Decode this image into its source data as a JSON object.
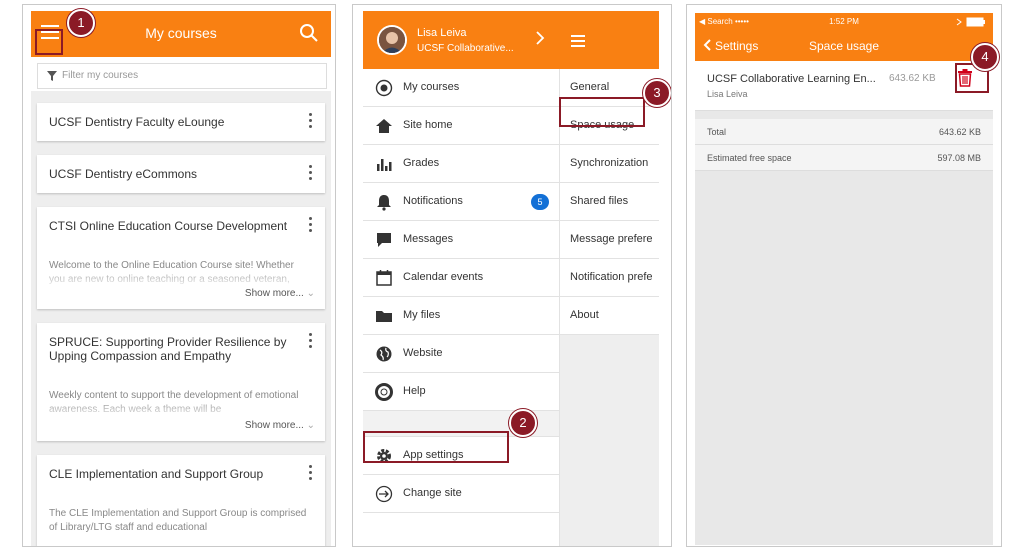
{
  "colors": {
    "brand": "#f98012",
    "callout": "#8b1a26",
    "badge_blue": "#1370d6"
  },
  "callouts": [
    "1",
    "2",
    "3",
    "4"
  ],
  "screen1": {
    "title": "My courses",
    "filter_placeholder": "Filter my courses",
    "courses": [
      {
        "title": "UCSF Dentistry Faculty eLounge"
      },
      {
        "title": "UCSF Dentistry eCommons"
      },
      {
        "title": "CTSI Online Education Course Development",
        "description": "Welcome to the Online Education Course site! Whether you are new to online teaching or a seasoned veteran,",
        "show_more": "Show more..."
      },
      {
        "title": "SPRUCE: Supporting Provider Resilience by Upping Compassion and Empathy",
        "description": "Weekly content to support the development of emotional awareness. Each week a theme will be",
        "show_more": "Show more..."
      },
      {
        "title": "CLE Implementation and Support Group",
        "description": "The CLE Implementation and Support Group is comprised of Library/LTG staff and educational"
      }
    ]
  },
  "screen2": {
    "user_name": "Lisa Leiva",
    "user_site": "UCSF Collaborative...",
    "menu": [
      {
        "label": "My courses",
        "icon": "course-icon"
      },
      {
        "label": "Site home",
        "icon": "home-icon"
      },
      {
        "label": "Grades",
        "icon": "grades-icon"
      },
      {
        "label": "Notifications",
        "icon": "bell-icon",
        "count": "5"
      },
      {
        "label": "Messages",
        "icon": "chat-icon"
      },
      {
        "label": "Calendar events",
        "icon": "calendar-icon"
      },
      {
        "label": "My files",
        "icon": "folder-icon"
      },
      {
        "label": "Website",
        "icon": "globe-icon"
      },
      {
        "label": "Help",
        "icon": "lifebuoy-icon"
      }
    ],
    "app_settings": "App settings",
    "change_site": "Change site",
    "submenu": [
      "General",
      "Space usage",
      "Synchronization",
      "Shared files",
      "Message prefere",
      "Notification prefe",
      "About"
    ]
  },
  "screen3": {
    "status_left": "Search",
    "status_time": "1:52 PM",
    "back_label": "Settings",
    "title": "Space usage",
    "site_name": "UCSF Collaborative Learning En...",
    "site_size": "643.62 KB",
    "site_user": "Lisa Leiva",
    "rows": [
      {
        "label": "Total",
        "value": "643.62 KB"
      },
      {
        "label": "Estimated free space",
        "value": "597.08 MB"
      }
    ]
  }
}
